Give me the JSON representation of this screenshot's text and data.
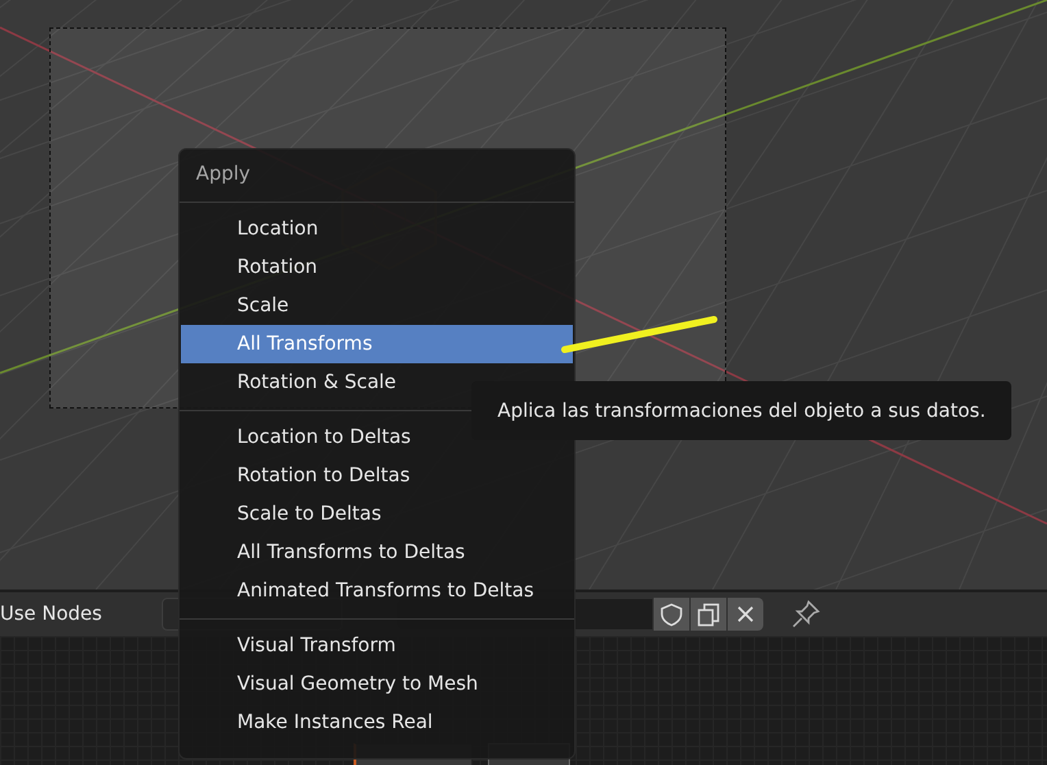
{
  "header": {
    "use_nodes_label": "Use Nodes"
  },
  "menu": {
    "title": "Apply",
    "groups": [
      [
        {
          "label": "Location",
          "selected": false
        },
        {
          "label": "Rotation",
          "selected": false
        },
        {
          "label": "Scale",
          "selected": false
        },
        {
          "label": "All Transforms",
          "selected": true
        },
        {
          "label": "Rotation & Scale",
          "selected": false
        }
      ],
      [
        {
          "label": "Location to Deltas",
          "selected": false
        },
        {
          "label": "Rotation to Deltas",
          "selected": false
        },
        {
          "label": "Scale to Deltas",
          "selected": false
        },
        {
          "label": "All Transforms to Deltas",
          "selected": false
        },
        {
          "label": "Animated Transforms to Deltas",
          "selected": false
        }
      ],
      [
        {
          "label": "Visual Transform",
          "selected": false
        },
        {
          "label": "Visual Geometry to Mesh",
          "selected": false
        },
        {
          "label": "Make Instances Real",
          "selected": false
        }
      ]
    ]
  },
  "tooltip": {
    "text": "Aplica las transformaciones del objeto a sus datos."
  }
}
